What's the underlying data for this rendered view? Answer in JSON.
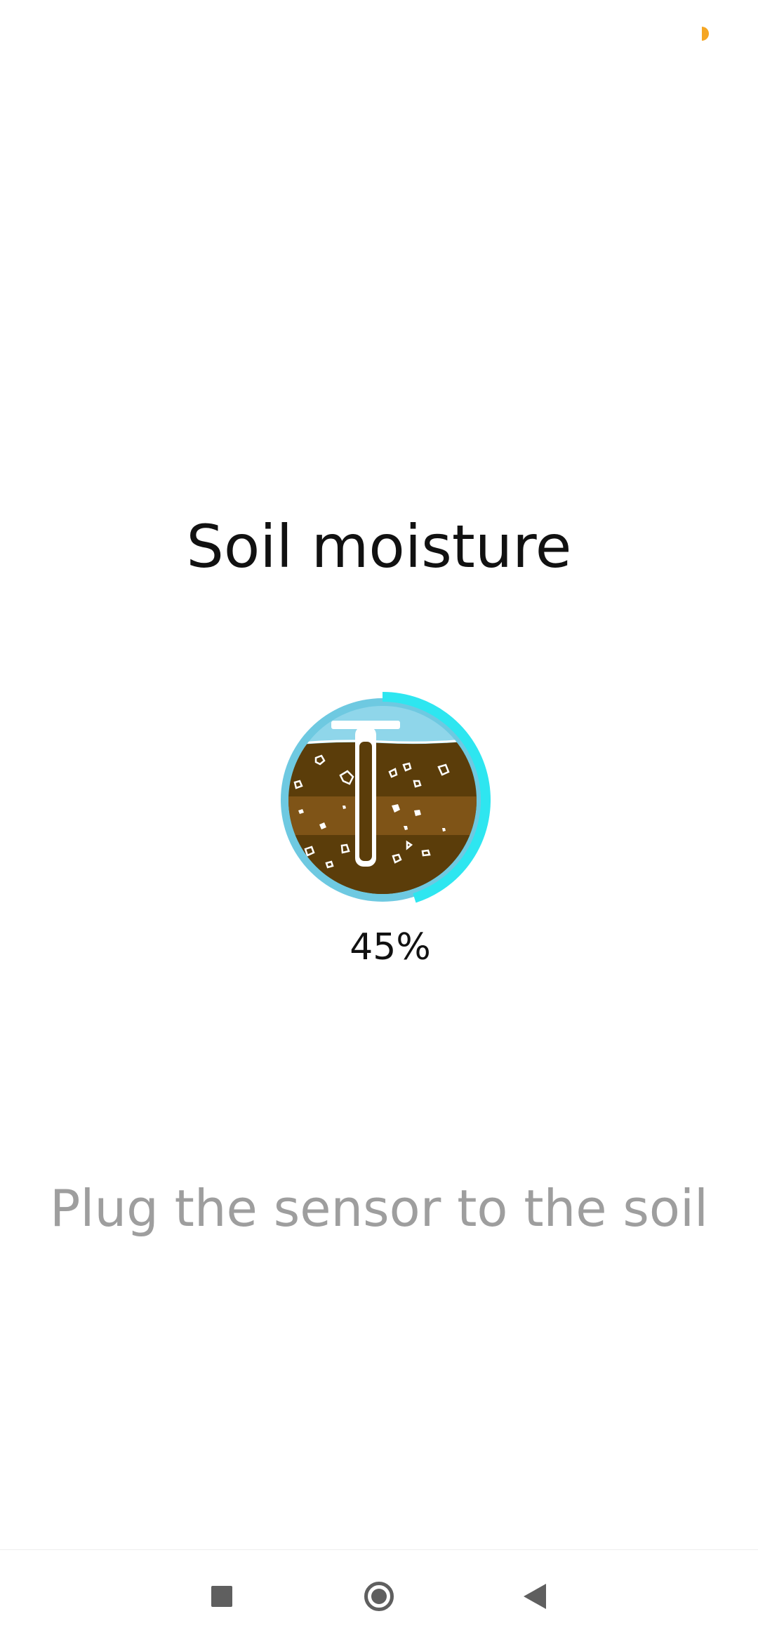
{
  "app": {
    "title": "Soil moisture",
    "hint": "Plug the sensor to the soil"
  },
  "sensor": {
    "moisture_label": "45%",
    "moisture_fraction": 0.45
  },
  "icons": {
    "status": "status-dot-icon",
    "gauge": "soil-sensor-gauge-icon",
    "recents": "recents-square-icon",
    "home": "home-circle-icon",
    "back": "back-triangle-icon"
  },
  "colors": {
    "accent": "#f5a623",
    "ring": "#2ee6f0",
    "sky": "#8fd6ea",
    "soil_dark": "#5b3d0a",
    "soil_mid": "#7f5417",
    "text": "#111111",
    "muted": "#9e9e9e"
  }
}
